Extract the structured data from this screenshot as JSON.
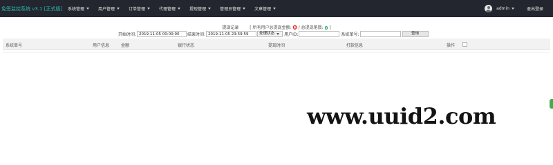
{
  "header": {
    "brand": "免签监控系统 v3.1 [正式版]",
    "menu": [
      {
        "label": "系统管理"
      },
      {
        "label": "用户管理"
      },
      {
        "label": "订单管理"
      },
      {
        "label": "代理管理"
      },
      {
        "label": "提现管理"
      },
      {
        "label": "管理员管理"
      },
      {
        "label": "文章管理"
      }
    ],
    "user": "admin",
    "logout": "退出登录"
  },
  "summary": {
    "title": "提现记录",
    "prefix": "[ 所有用户总提现金额:",
    "total_amount": "0",
    "separator": "/ 总提现笔数:",
    "total_count": "0",
    "suffix": "]"
  },
  "filters": {
    "start_label": "开始时间:",
    "start_value": "2019-11-05 00:00:00",
    "end_label": "结束时间:",
    "end_value": "2019-11-05 23:59:59",
    "status_select": "处理状态",
    "user_id_label": "用户ID:",
    "user_id_value": "",
    "order_no_label": "系统单号:",
    "order_no_value": "",
    "query_button": "查询"
  },
  "table": {
    "columns": [
      "系统单号",
      "用户信息",
      "金额",
      "银行状态",
      "提现时间",
      "打款信息",
      "操作"
    ]
  },
  "watermark": "www.uuid2.com",
  "colors": {
    "topbar": "#23262e",
    "brand": "#2fb6b0",
    "amount": "#e4251c",
    "count": "#26a65b"
  }
}
